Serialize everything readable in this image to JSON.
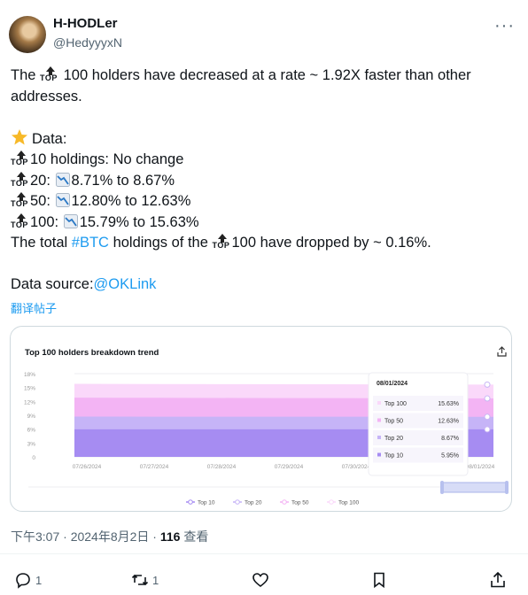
{
  "author": {
    "name": "H-HODLer",
    "handle": "@HedyyyxN"
  },
  "tweet": {
    "line1_pre": "The ",
    "top_label": "TOP",
    "line1_post": " 100  holders have decreased at a rate ~ 1.92X faster than other",
    "line2": "addresses.",
    "data_label": "Data:",
    "row10": "10 holdings: No change",
    "row20_pre": "20: ",
    "row20_val": "8.71% to 8.67%",
    "row50_pre": "50: ",
    "row50_val": "12.80% to 12.63%",
    "row100_pre": "100: ",
    "row100_val": "15.79% to 15.63%",
    "total_pre": "The total ",
    "total_tag": "#BTC",
    "total_mid": "  holdings of the ",
    "total_post": "100 have dropped by ~ 0.16%.",
    "source_pre": "Data source:",
    "source_link": "@OKLink",
    "translate": "翻译帖子"
  },
  "chart_data": {
    "type": "area",
    "title": "Top 100 holders breakdown trend",
    "x": [
      "07/26/2024",
      "07/27/2024",
      "07/28/2024",
      "07/29/2024",
      "07/30/2024",
      "08/01/2024"
    ],
    "y_ticks": [
      "18%",
      "15%",
      "12%",
      "9%",
      "6%",
      "3%",
      "0"
    ],
    "ylim": [
      0,
      18
    ],
    "series": [
      {
        "name": "Top 10",
        "values": [
          5.95,
          5.95,
          5.95,
          5.95,
          5.95,
          5.95
        ],
        "color": "#a68cf2"
      },
      {
        "name": "Top 20",
        "values": [
          8.71,
          8.7,
          8.7,
          8.69,
          8.68,
          8.67
        ],
        "color": "#c6b4f7"
      },
      {
        "name": "Top 50",
        "values": [
          12.8,
          12.77,
          12.74,
          12.71,
          12.67,
          12.63
        ],
        "color": "#f3b4f4"
      },
      {
        "name": "Top 100",
        "values": [
          15.79,
          15.76,
          15.73,
          15.7,
          15.66,
          15.63
        ],
        "color": "#fad8fa"
      }
    ],
    "tooltip": {
      "date": "08/01/2024",
      "rows": [
        {
          "name": "Top 100",
          "value": "15.63%"
        },
        {
          "name": "Top 50",
          "value": "12.63%"
        },
        {
          "name": "Top 20",
          "value": "8.67%"
        },
        {
          "name": "Top 10",
          "value": "5.95%"
        }
      ]
    },
    "legend_position": "bottom"
  },
  "meta": {
    "time": "下午3:07 · 2024年8月2日 · ",
    "views": "116",
    "views_label": " 查看"
  },
  "actions": {
    "replies": "1",
    "reposts": "1"
  },
  "colors": {
    "link": "#1d9bf0",
    "muted": "#536471"
  }
}
